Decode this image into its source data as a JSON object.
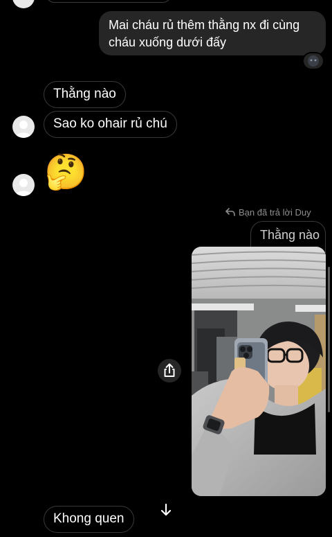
{
  "messages": {
    "outgoing_1": "Mai cháu rủ thêm thằng nx đi cùng cháu xuống dưới đấy",
    "incoming_1": "Thằng nào",
    "incoming_2": "Sao ko ohair rủ chú",
    "emoji": "🤔",
    "reply_header": "Bạn đã trả lời Duy",
    "quoted": "Thằng nào",
    "incoming_3": "Khong quen"
  },
  "icons": {
    "reaction": "dark-avatar-reaction",
    "reply": "reply-arrow-icon",
    "share": "share-icon",
    "scroll": "arrow-down-icon"
  }
}
